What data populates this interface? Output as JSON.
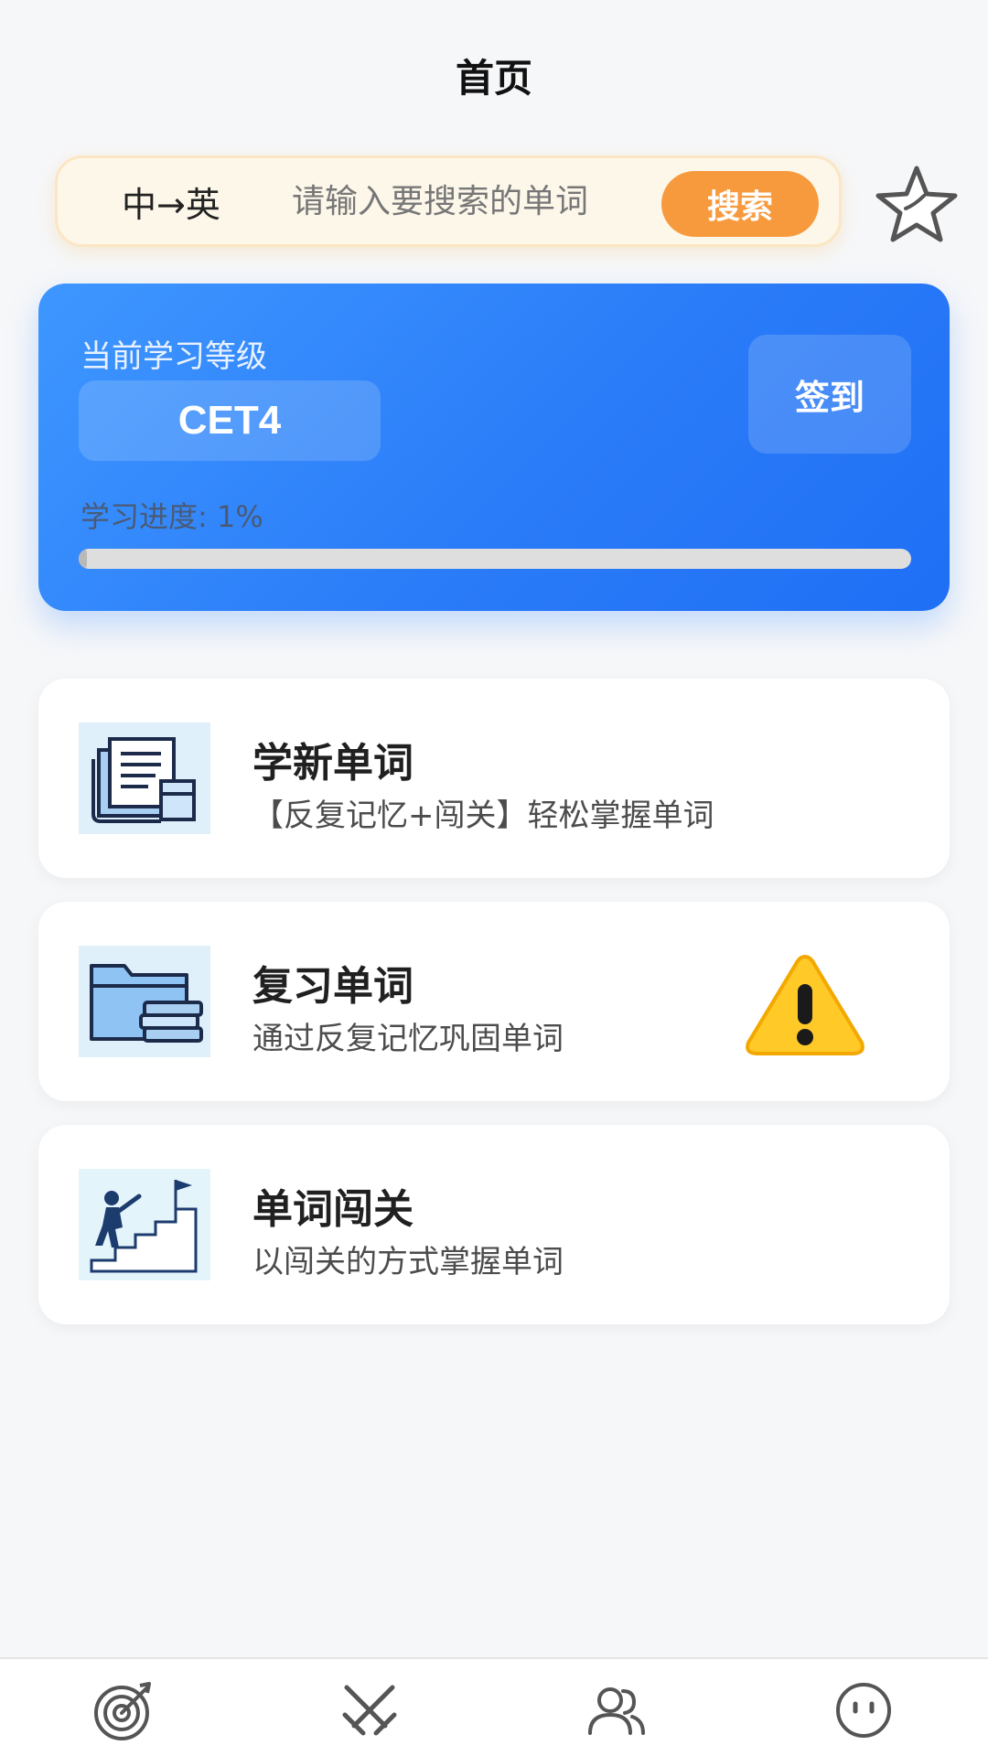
{
  "header": {
    "title": "首页"
  },
  "search": {
    "direction": "中→英",
    "placeholder": "请输入要搜索的单词",
    "button_label": "搜索"
  },
  "level_card": {
    "label": "当前学习等级",
    "level": "CET4",
    "checkin_label": "签到",
    "progress_text": "学习进度: 1%",
    "progress_fraction": 0.01
  },
  "features": [
    {
      "title": "学新单词",
      "description": "【反复记忆+闯关】轻松掌握单词",
      "icon": "books-icon"
    },
    {
      "title": "复习单词",
      "description": "通过反复记忆巩固单词",
      "icon": "folder-books-icon",
      "badge_icon": "warning-icon"
    },
    {
      "title": "单词闯关",
      "description": "以闯关的方式掌握单词",
      "icon": "stairs-climber-icon"
    }
  ],
  "bottom_nav": [
    {
      "icon": "target-icon"
    },
    {
      "icon": "crossed-swords-icon"
    },
    {
      "icon": "users-icon"
    },
    {
      "icon": "smiley-icon"
    }
  ],
  "colors": {
    "accent_orange": "#f79a3e",
    "card_blue": "#2b7cf8",
    "background": "#f6f7f9"
  }
}
